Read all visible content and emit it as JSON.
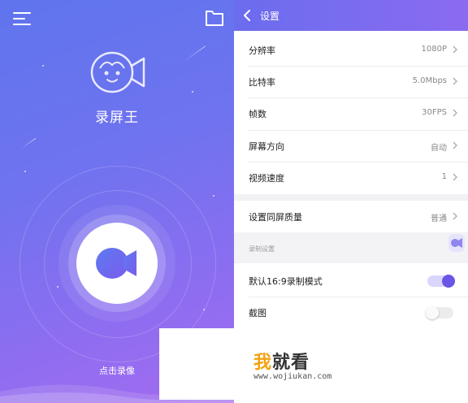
{
  "left_screen": {
    "app_name": "录屏王",
    "record_label": "点击录像",
    "colors": {
      "gradient_start": "#5f74ee",
      "gradient_end": "#a46cf0"
    },
    "icons": {
      "menu": "menu-icon",
      "folder": "folder-icon",
      "logo": "camera-face-logo",
      "record": "camera-icon"
    }
  },
  "right_screen": {
    "header": {
      "title": "设置",
      "back_icon": "chevron-left-icon"
    },
    "settings": [
      {
        "label": "分辨率",
        "value": "1080P"
      },
      {
        "label": "比特率",
        "value": "5.0Mbps"
      },
      {
        "label": "帧数",
        "value": "30FPS"
      },
      {
        "label": "屏幕方向",
        "value": "自动"
      },
      {
        "label": "视频速度",
        "value": "1"
      }
    ],
    "mirror_quality": {
      "label": "设置同屏质量",
      "value": "普通"
    },
    "record_section": {
      "header": "录制设置",
      "toggles": [
        {
          "label": "默认16:9录制模式",
          "on": true
        },
        {
          "label": "截图",
          "on": false
        }
      ]
    },
    "colors": {
      "accent": "#6a56e6",
      "header": "#6b6cee"
    }
  },
  "watermark": {
    "logo_part1": "我",
    "logo_part2": "就看",
    "url": "www.wojiukan.com"
  }
}
